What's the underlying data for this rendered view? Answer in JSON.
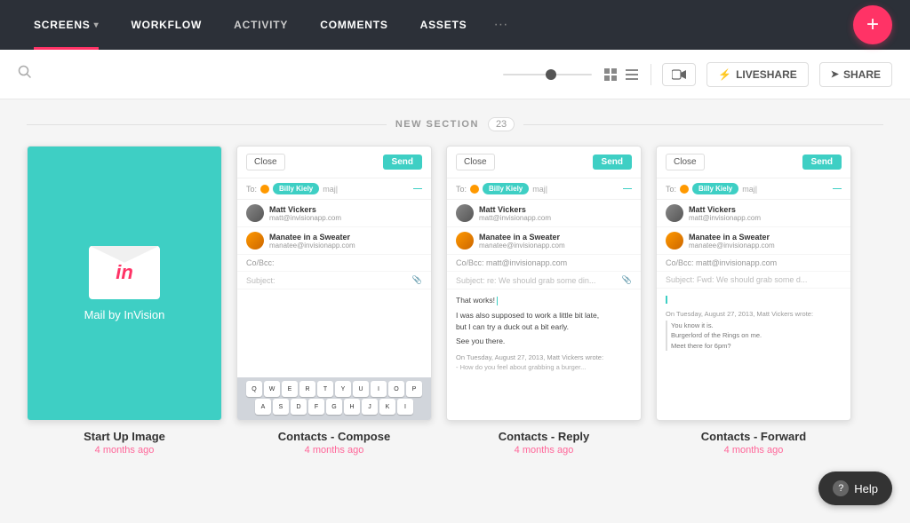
{
  "nav": {
    "items": [
      {
        "id": "screens",
        "label": "SCREENS",
        "active": true,
        "hasChevron": true
      },
      {
        "id": "workflow",
        "label": "WORKFLOW",
        "active": false
      },
      {
        "id": "activity",
        "label": "ACTIVITY",
        "active": false
      },
      {
        "id": "comments",
        "label": "COMMENTS",
        "active": false
      },
      {
        "id": "assets",
        "label": "ASSETS",
        "active": false
      }
    ],
    "more_label": "···",
    "add_label": "+"
  },
  "toolbar": {
    "liveshare_label": "LIVESHARE",
    "share_label": "SHARE"
  },
  "section": {
    "title": "NEW SECTION",
    "count": "23"
  },
  "cards": [
    {
      "id": "startup",
      "type": "startup",
      "label": "Start Up Image",
      "time": "4 months ago"
    },
    {
      "id": "compose",
      "type": "email",
      "label": "Contacts - Compose",
      "time": "4 months ago",
      "close": "Close",
      "send": "Send",
      "to_label": "To:",
      "to_chip": "Billy Kiely",
      "to_input": "maj",
      "contact1_name": "Matt Vickers",
      "contact1_email": "matt@invisionapp.com",
      "contact2_name": "Manatee in a Sweater",
      "contact2_email": "manatee@invisionapp.com",
      "cc": "Co/Bcc:",
      "subject": "Subject:",
      "keyboard": true,
      "has_body": false
    },
    {
      "id": "reply",
      "type": "email",
      "label": "Contacts - Reply",
      "time": "4 months ago",
      "close": "Close",
      "send": "Send",
      "to_label": "To:",
      "to_chip": "Billy Kiely",
      "to_input": "maj",
      "contact1_name": "Matt Vickers",
      "contact1_email": "matt@invisionapp.com",
      "contact2_name": "Manatee in a Sweater",
      "contact2_email": "manatee@invisionapp.com",
      "cc": "Co/Bcc: matt@invisionapp.com",
      "subject": "Subject: re: We should grab some din...",
      "keyboard": false,
      "has_body": true,
      "body_lines": [
        "That works!",
        "",
        "I was also supposed to work a little bit late,",
        "but I can try a duck out a bit early.",
        "",
        "See you there."
      ],
      "quoted": "On Tuesday, August 27, 2013, Matt Vickers wrote:",
      "quoted2": "- How do you feel about grabbing a burger..."
    },
    {
      "id": "forward",
      "type": "email",
      "label": "Contacts - Forward",
      "time": "4 months ago",
      "close": "Close",
      "send": "Send",
      "to_label": "To:",
      "to_chip": "Billy Kiely",
      "to_input": "maj",
      "contact1_name": "Matt Vickers",
      "contact1_email": "matt@invisionapp.com",
      "contact2_name": "Manatee in a Sweater",
      "contact2_email": "manatee@invisionapp.com",
      "cc": "Co/Bcc: matt@invisionapp.com",
      "subject": "Subject: Fwd: We should grab some d...",
      "keyboard": false,
      "has_body": true,
      "body_lines": [],
      "quoted": "On Tuesday, August 27, 2013, Matt Vickers wrote:",
      "quoted2": "You know it is.",
      "quoted3": "Burgerlord of the Rings on me.",
      "quoted4": "Meet there for 6pm?"
    }
  ],
  "help": {
    "label": "Help"
  },
  "keyboard_rows": [
    [
      "Q",
      "W",
      "E",
      "R",
      "T",
      "Y",
      "U",
      "I",
      "O",
      "P"
    ],
    [
      "A",
      "S",
      "D",
      "F",
      "G",
      "H",
      "J",
      "K",
      "I"
    ]
  ]
}
